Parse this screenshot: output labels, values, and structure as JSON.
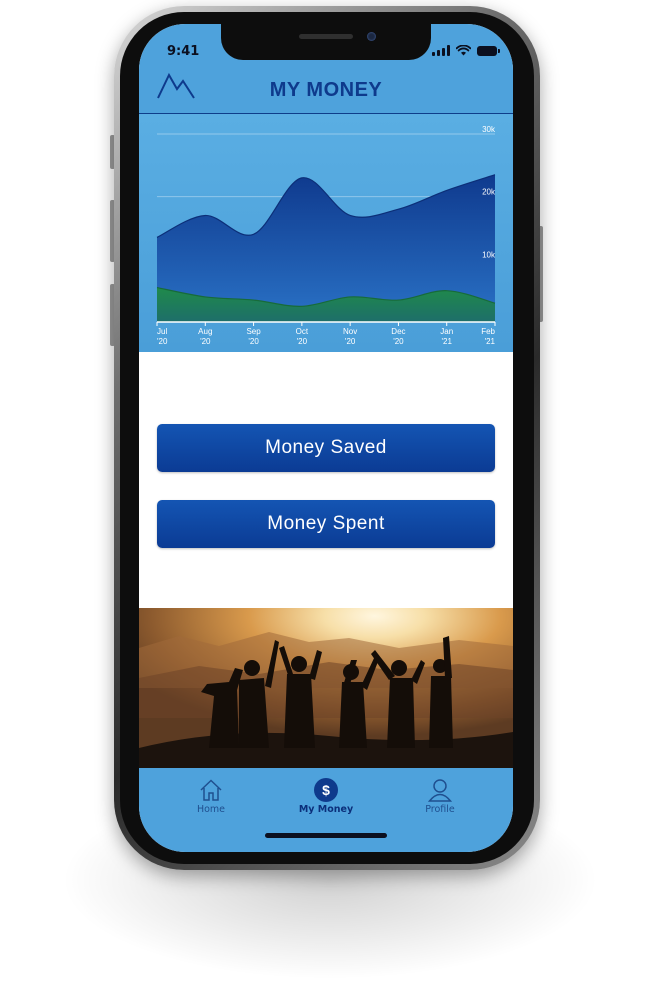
{
  "status_bar": {
    "time": "9:41"
  },
  "header": {
    "title": "MY MONEY",
    "logo_icon": "mountain-logo-icon"
  },
  "colors": {
    "header_bg": "#4ea2dc",
    "title": "#0e3a8c",
    "button_top": "#1455b3",
    "button_bottom": "#0b3b94",
    "chart_bg": "#5aaee3",
    "series_total": "#0e3a8c",
    "series_saved": "#1f8a4a"
  },
  "chart_data": {
    "type": "area",
    "x": [
      "Jul '20",
      "Aug '20",
      "Sep '20",
      "Oct '20",
      "Nov '20",
      "Dec '20",
      "Jan '21",
      "Feb '21"
    ],
    "x_ticks": [
      {
        "month": "Jul",
        "year": "'20"
      },
      {
        "month": "Aug",
        "year": "'20"
      },
      {
        "month": "Sep",
        "year": "'20"
      },
      {
        "month": "Oct",
        "year": "'20"
      },
      {
        "month": "Nov",
        "year": "'20"
      },
      {
        "month": "Dec",
        "year": "'20"
      },
      {
        "month": "Jan",
        "year": "'21"
      },
      {
        "month": "Feb",
        "year": "'21"
      }
    ],
    "series": [
      {
        "values": [
          13500,
          17000,
          14000,
          23000,
          17000,
          18000,
          21000,
          23500
        ]
      },
      {
        "values": [
          5500,
          4000,
          3500,
          2500,
          4000,
          3500,
          5000,
          3000
        ]
      }
    ],
    "y_ticks": [
      {
        "value": 10000,
        "label": "10k"
      },
      {
        "value": 20000,
        "label": "20k"
      },
      {
        "value": 30000,
        "label": "30k"
      }
    ],
    "ylim": [
      0,
      30000
    ],
    "grid": true
  },
  "buttons": {
    "saved": "Money Saved",
    "spent": "Money Spent"
  },
  "tabs": [
    {
      "label": "Home",
      "icon": "home-icon"
    },
    {
      "label": "My Money",
      "icon": "dollar-icon"
    },
    {
      "label": "Profile",
      "icon": "profile-icon"
    }
  ]
}
